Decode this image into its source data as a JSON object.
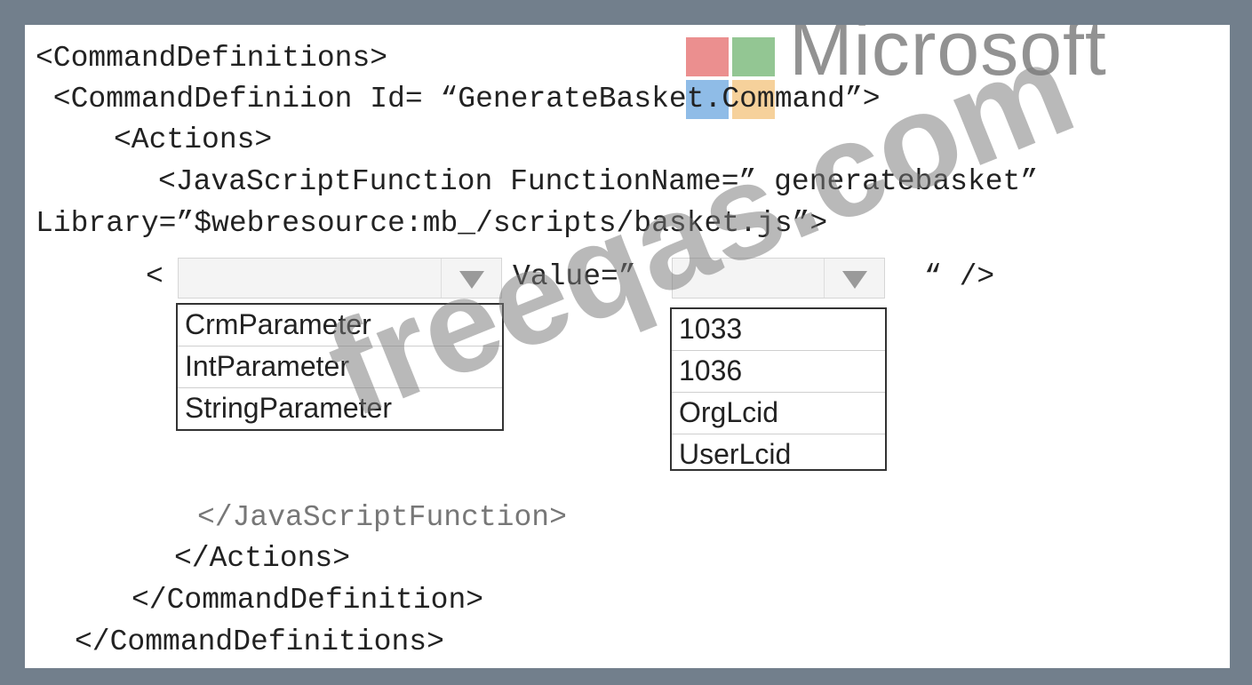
{
  "code": {
    "line1": "<CommandDefinitions>",
    "line2": " <CommandDefiniion Id= “GenerateBasket.Command”>",
    "line3": "<Actions>",
    "line4": "<JavaScriptFunction FunctionName=” generatebasket”",
    "line5": "Library=”$webresource:mb_/scripts/basket.js”>",
    "open_bracket": "<",
    "value_label": "Value=”",
    "close_tag": "“ />",
    "line_end_js": "</JavaScriptFunction>",
    "line_end_actions": "</Actions>",
    "line_end_def": "</CommandDefinition>",
    "line_end_defs": "</CommandDefinitions>"
  },
  "parameter_dropdown": {
    "selected": "",
    "options": [
      "CrmParameter",
      "IntParameter",
      "StringParameter"
    ]
  },
  "value_dropdown": {
    "selected": "",
    "options": [
      "1033",
      "1036",
      "OrgLcid",
      "UserLcid"
    ]
  },
  "logo": {
    "text": "Microsoft",
    "colors": [
      "#f25022",
      "#7fba00",
      "#00a4ef",
      "#ffb900"
    ]
  },
  "watermark": {
    "text": "freeqas.com"
  }
}
